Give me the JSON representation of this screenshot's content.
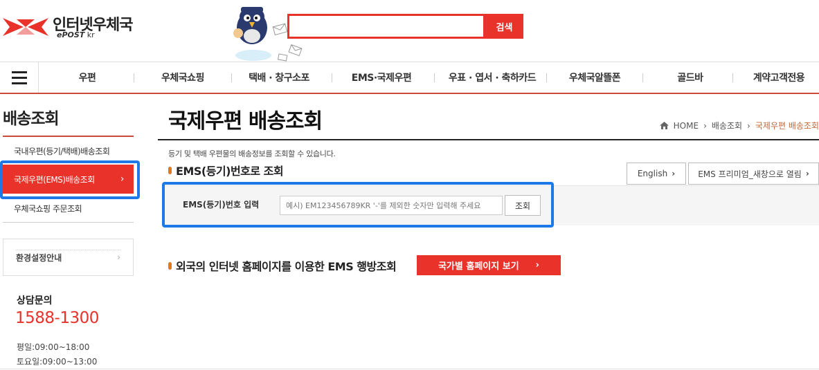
{
  "header": {
    "logo_name": "인터넷우체국",
    "logo_sub_main": "ePOST",
    "logo_sub_suffix": " kr",
    "search_placeholder": "",
    "search_button": "검색"
  },
  "gnb": {
    "items": [
      "우편",
      "우체국쇼핑",
      "택배 · 창구소포",
      "EMS·국제우편",
      "우표 · 엽서 · 축하카드",
      "우체국알뜰폰",
      "골드바",
      "계약고객전용"
    ]
  },
  "sidebar": {
    "title": "배송조회",
    "menu": [
      {
        "label": "국내우편(등기/택배)배송조회"
      },
      {
        "label": "국제우편(EMS)배송조회",
        "active": true
      },
      {
        "label": "우체국쇼핑 주문조회"
      }
    ],
    "env_label": "환경설정안내",
    "consult_label": "상담문의",
    "phone": "1588-1300",
    "hours_weekday": "평일:09:00~18:00",
    "hours_saturday": "토요일:09:00~13:00"
  },
  "main": {
    "page_title": "국제우편 배송조회",
    "breadcrumb": [
      "HOME",
      "배송조회",
      "국제우편 배송조회"
    ],
    "description": "등기 및 택배 우편물의 배송정보를 조회할 수 있습니다.",
    "section_title": "EMS(등기)번호로 조회",
    "english_button": "English",
    "premium_button": "EMS 프리미엄_새창으로 열림",
    "query_label": "EMS(등기)번호 입력",
    "query_placeholder": "예시) EM123456789KR '-'를 제외한 숫자만 입력해 주세요",
    "query_button": "조회",
    "foreign_title": "외국의 인터넷 홈페이지를 이용한 EMS 행방조회",
    "country_button": "국가별 홈페이지 보기"
  },
  "colors": {
    "accent_red": "#e8322a",
    "highlight_blue": "#1e78e6",
    "bullet_orange": "#e07a1e"
  }
}
